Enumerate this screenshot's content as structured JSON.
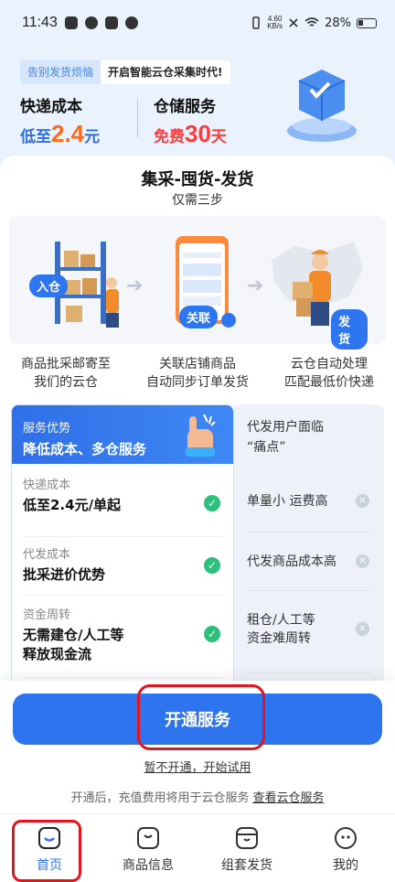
{
  "status_bar": {
    "time": "11:43",
    "net_speed_top": "4.60",
    "net_speed_bottom": "KB/s",
    "battery": "28%"
  },
  "hero": {
    "tag_left": "告别发货烦恼",
    "tag_right": "开启智能云仓采集时代!",
    "col1_title": "快递成本",
    "col1_prefix": "低至",
    "col1_number": "2.4",
    "col1_suffix": "元",
    "col2_title": "仓储服务",
    "col2_prefix": "免费",
    "col2_number": "30",
    "col2_suffix": "天"
  },
  "steps": {
    "title": "集采-囤货-发货",
    "subtitle": "仅需三步",
    "badges": [
      "入仓",
      "关联",
      "发货"
    ],
    "captions": [
      [
        "商品批采邮寄至",
        "我们的云仓"
      ],
      [
        "关联店铺商品",
        "自动同步订单发货"
      ],
      [
        "云仓自动处理",
        "匹配最低价快递"
      ]
    ]
  },
  "advantages": {
    "head_small": "服务优势",
    "head_big": "降低成本、多仓服务",
    "rows": [
      {
        "label": "快递成本",
        "value": "低至2.4元/单起"
      },
      {
        "label": "代发成本",
        "value": "批采进价优势"
      },
      {
        "label": "资金周转",
        "value_lines": [
          "无需建仓/人工等",
          "释放现金流"
        ]
      }
    ]
  },
  "pain_points": {
    "head_lines": [
      "代发用户面临",
      "“痛点”"
    ],
    "rows": [
      {
        "lines": [
          "单量小 运费高"
        ]
      },
      {
        "lines": [
          "代发商品成本高"
        ]
      },
      {
        "lines": [
          "租仓/人工等",
          "资金难周转"
        ]
      }
    ]
  },
  "cta": {
    "button": "开通服务",
    "trial_link": "暂不开通，开始试用",
    "note": "开通后，充值费用将用于云仓服务",
    "note_link": "查看云仓服务"
  },
  "tabs": [
    {
      "label": "首页",
      "icon": "home-icon",
      "active": true
    },
    {
      "label": "商品信息",
      "icon": "product-icon",
      "active": false
    },
    {
      "label": "组套发货",
      "icon": "bundle-ship-icon",
      "active": false
    },
    {
      "label": "我的",
      "icon": "profile-icon",
      "active": false
    }
  ],
  "colors": {
    "primary": "#2f74ef",
    "highlight": "#e3141e",
    "price_orange": "#ff6a1a",
    "price_red": "#ff3d3d",
    "check_green": "#2cc07a"
  }
}
